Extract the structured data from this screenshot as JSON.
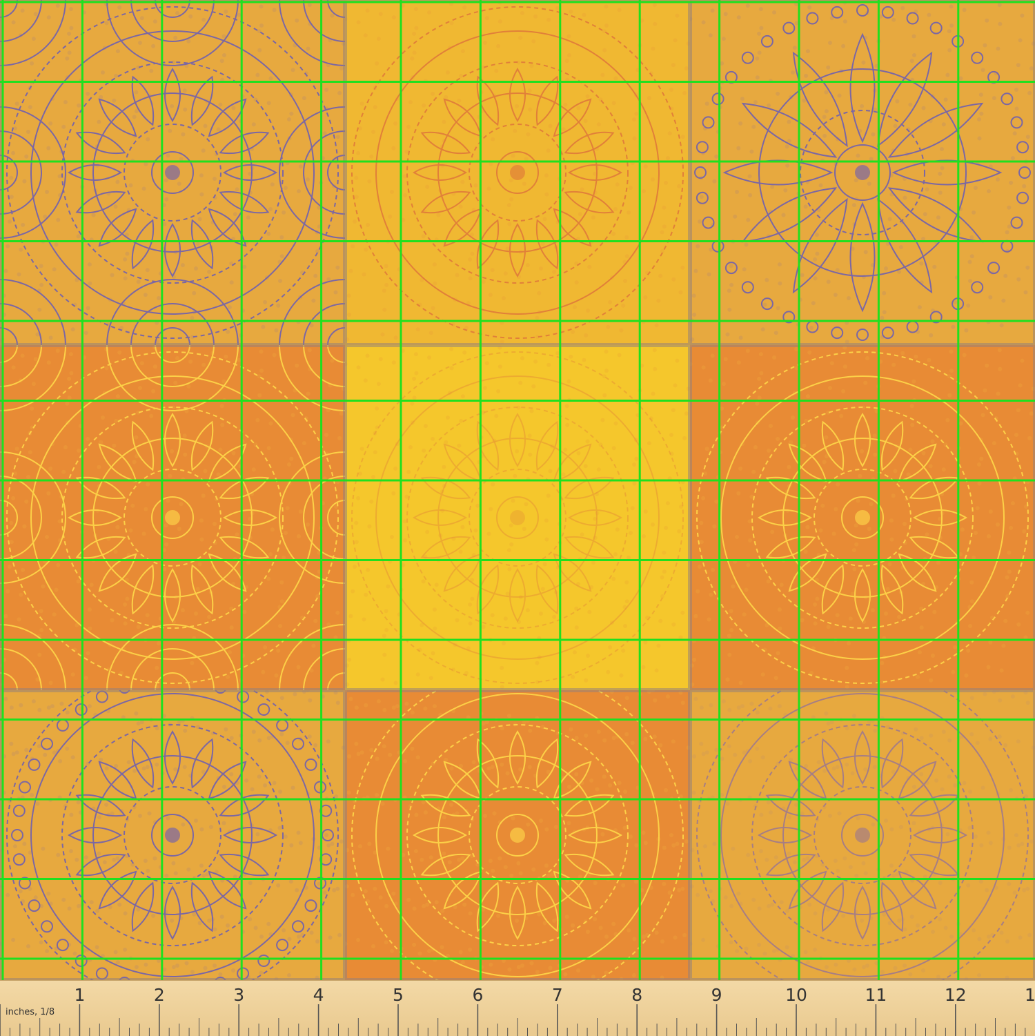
{
  "ruler": {
    "unit_label": "inches, 1/8",
    "numbers": [
      "1",
      "2",
      "3",
      "4",
      "5",
      "6",
      "7",
      "8",
      "9",
      "10",
      "11",
      "12",
      "1"
    ]
  },
  "colors": {
    "grid_line": "#1fe01f",
    "ruler_bg": "#f0d49c",
    "purple_line": "#7060b0",
    "tan_bg": "#e7a93f",
    "orange_bg": "#e88b35",
    "golden_bg": "#f0b832",
    "yellow_bg": "#f5c72c",
    "yellow_line": "#ffd84a",
    "orange_line": "#e07a3a",
    "faint_purple": "#a07a8c"
  },
  "panels": [
    {
      "name": "panel-purple-mandala-top-left",
      "bg": "tan_bg",
      "line": "purple_line",
      "motif": "dense"
    },
    {
      "name": "panel-orange-mandala-top-center",
      "bg": "golden_bg",
      "line": "orange_line",
      "motif": "rings"
    },
    {
      "name": "panel-purple-flower-top-right",
      "bg": "tan_bg",
      "line": "purple_line",
      "motif": "flower"
    },
    {
      "name": "panel-orange-lace-middle-left",
      "bg": "orange_bg",
      "line": "yellow_line",
      "motif": "dense"
    },
    {
      "name": "panel-yellow-center",
      "bg": "yellow_bg",
      "line": "orange_line",
      "motif": "faint"
    },
    {
      "name": "panel-orange-middle-right",
      "bg": "orange_bg",
      "line": "yellow_line",
      "motif": "rings"
    },
    {
      "name": "panel-purple-mandala-bottom-left",
      "bg": "tan_bg",
      "line": "purple_line",
      "motif": "beaded"
    },
    {
      "name": "panel-orange-bottom-center",
      "bg": "orange_bg",
      "line": "yellow_line",
      "motif": "rings"
    },
    {
      "name": "panel-tan-bottom-right",
      "bg": "tan_bg",
      "line": "faint_purple",
      "motif": "rings"
    }
  ]
}
